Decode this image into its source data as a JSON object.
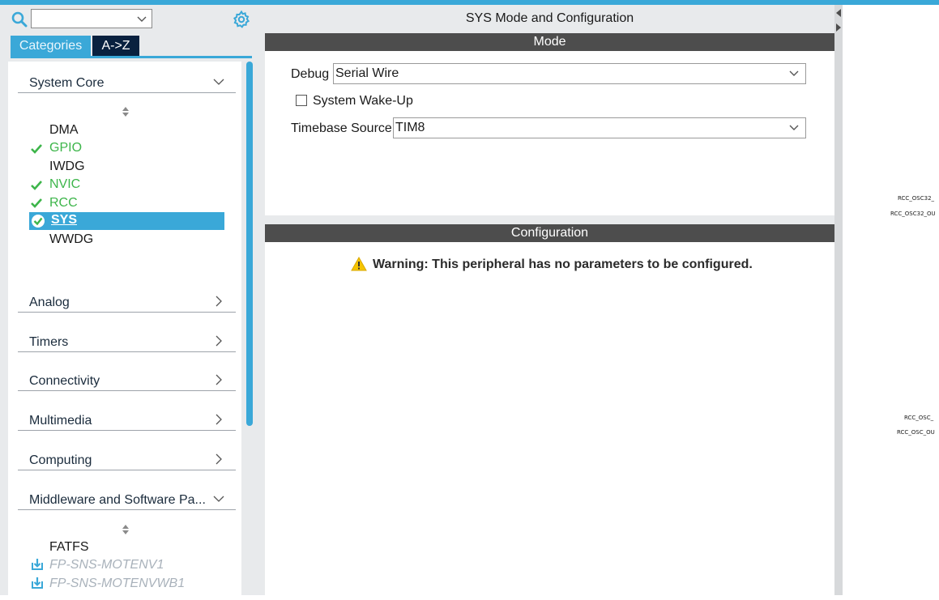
{
  "colors": {
    "accent": "#3aa8d8",
    "dark_tab": "#09213f",
    "ok_green": "#3db54a",
    "bar_gray": "#4d4d4d",
    "warning_yellow": "#f5c400"
  },
  "left_panel": {
    "search": {
      "value": "",
      "icons": [
        "search-icon",
        "chevron-down-icon"
      ]
    },
    "settings_icon": "gear-icon",
    "tabs": [
      {
        "label": "Categories",
        "active": true
      },
      {
        "label": "A->Z",
        "active": false
      }
    ],
    "categories": [
      {
        "label": "System Core",
        "expanded": true
      },
      {
        "label": "Analog",
        "expanded": false
      },
      {
        "label": "Timers",
        "expanded": false
      },
      {
        "label": "Connectivity",
        "expanded": false
      },
      {
        "label": "Multimedia",
        "expanded": false
      },
      {
        "label": "Computing",
        "expanded": false
      },
      {
        "label": "Middleware and Software Pa...",
        "expanded": true
      }
    ],
    "system_core_items": [
      {
        "label": "DMA",
        "status": "none"
      },
      {
        "label": "GPIO",
        "status": "configured"
      },
      {
        "label": "IWDG",
        "status": "none"
      },
      {
        "label": "NVIC",
        "status": "configured"
      },
      {
        "label": "RCC",
        "status": "configured"
      },
      {
        "label": "SYS",
        "status": "selected"
      },
      {
        "label": "WWDG",
        "status": "none"
      }
    ],
    "middleware_items": [
      {
        "label": "FATFS",
        "status": "none"
      },
      {
        "label": "FP-SNS-MOTENV1",
        "status": "pack"
      },
      {
        "label": "FP-SNS-MOTENVWB1",
        "status": "pack"
      }
    ]
  },
  "center_panel": {
    "title": "SYS Mode and Configuration",
    "mode_header": "Mode",
    "debug": {
      "label": "Debug",
      "value": "Serial Wire"
    },
    "wakeup": {
      "label": "System Wake-Up",
      "checked": false
    },
    "timebase": {
      "label": "Timebase Source",
      "value": "TIM8"
    },
    "config_header": "Configuration",
    "warning": {
      "icon": "warning-icon",
      "text": "Warning: This peripheral has no parameters to be configured."
    }
  },
  "pinout_canvas": {
    "pin_labels": [
      "RCC_OSC32_",
      "RCC_OSC32_OU",
      "RCC_OSC_",
      "RCC_OSC_OU"
    ]
  }
}
